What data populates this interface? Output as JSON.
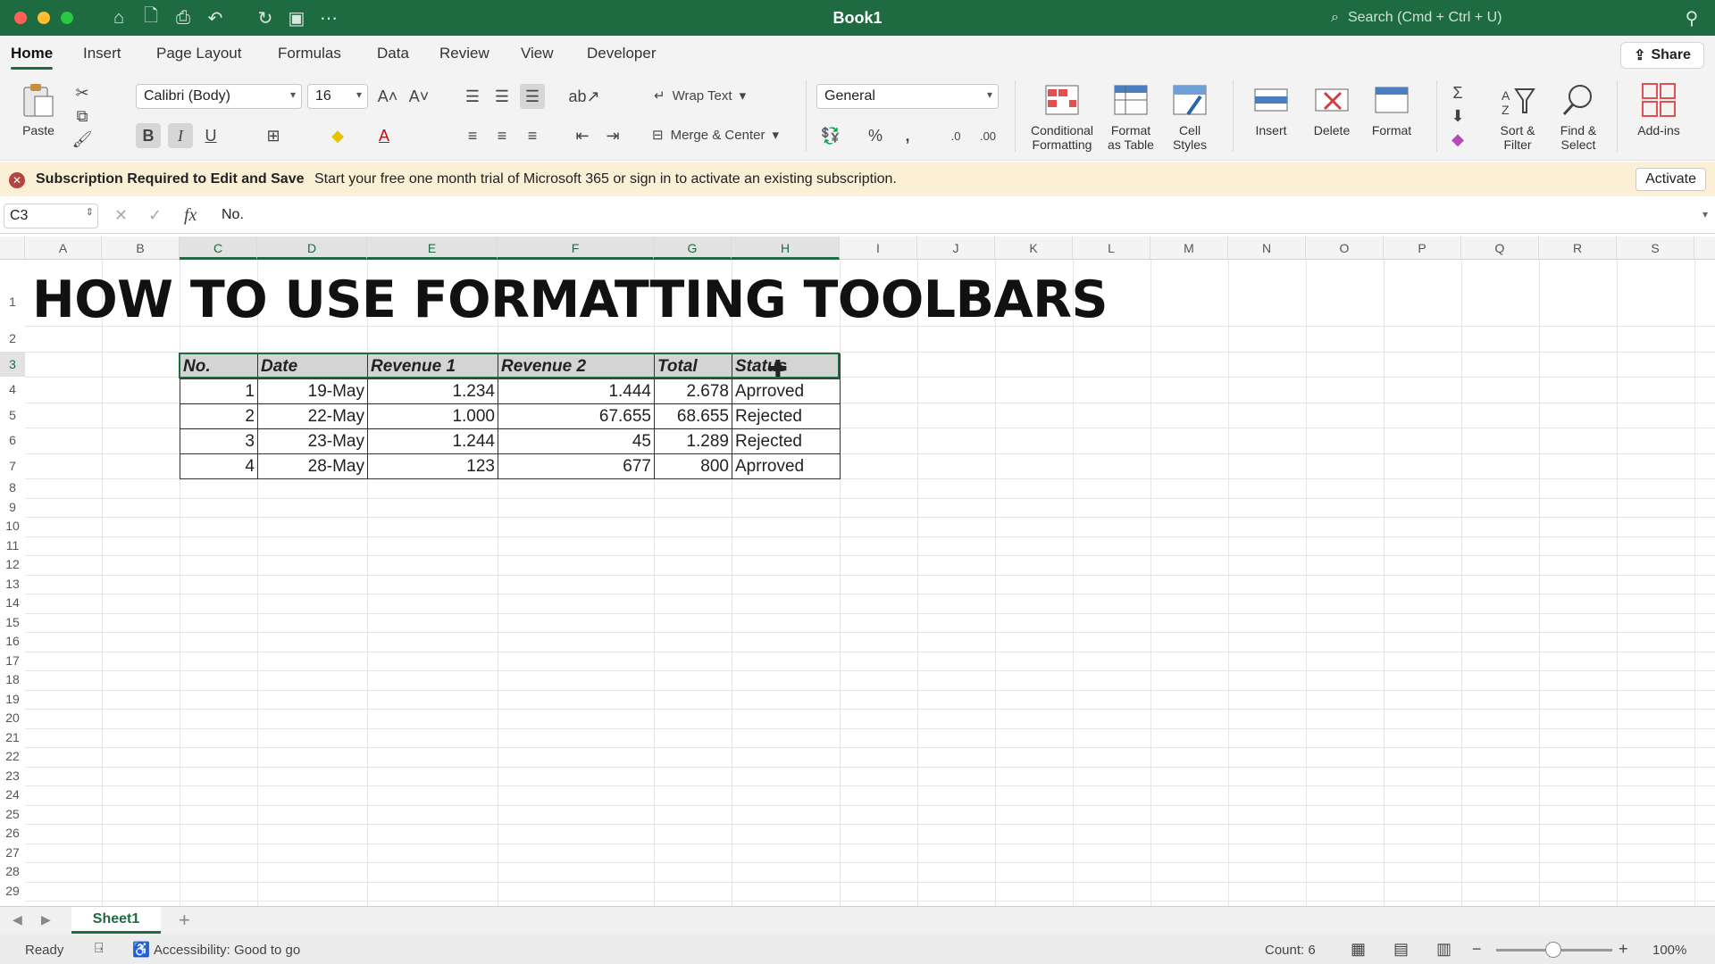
{
  "app": {
    "title": "Book1",
    "search_placeholder": "Search (Cmd + Ctrl + U)"
  },
  "tabs": [
    "Home",
    "Insert",
    "Page Layout",
    "Formulas",
    "Data",
    "Review",
    "View",
    "Developer"
  ],
  "share_label": "Share",
  "ribbon": {
    "paste": "Paste",
    "font_name": "Calibri (Body)",
    "font_size": "16",
    "wrap_text": "Wrap Text",
    "merge_center": "Merge & Center",
    "number_format": "General",
    "conditional_formatting": [
      "Conditional",
      "Formatting"
    ],
    "format_as_table": [
      "Format",
      "as Table"
    ],
    "cell_styles": [
      "Cell",
      "Styles"
    ],
    "insert": "Insert",
    "delete": "Delete",
    "format": "Format",
    "sort_filter": [
      "Sort &",
      "Filter"
    ],
    "find_select": [
      "Find &",
      "Select"
    ],
    "add_ins": "Add-ins",
    "bold": "B",
    "italic": "I",
    "underline": "U"
  },
  "message": {
    "title": "Subscription Required to Edit and Save",
    "text": "Start your free one month trial of Microsoft 365 or sign in to activate an existing subscription.",
    "button": "Activate"
  },
  "formula_bar": {
    "cell_ref": "C3",
    "formula": "No."
  },
  "columns": [
    "A",
    "B",
    "C",
    "D",
    "E",
    "F",
    "G",
    "H",
    "I",
    "J",
    "K",
    "L",
    "M",
    "N",
    "O",
    "P",
    "Q",
    "R",
    "S"
  ],
  "rows": [
    "1",
    "2",
    "3",
    "4",
    "5",
    "6",
    "7",
    "8",
    "9",
    "10",
    "11",
    "12",
    "13",
    "14",
    "15",
    "16",
    "17",
    "18",
    "19",
    "20",
    "21",
    "22",
    "23",
    "24",
    "25",
    "26",
    "27",
    "28",
    "29"
  ],
  "sheet": {
    "title": "HOW TO USE FORMATTING TOOLBARS",
    "table_headers": [
      "No.",
      "Date",
      "Revenue 1",
      "Revenue 2",
      "Total",
      "Status"
    ],
    "table_rows": [
      [
        "1",
        "19-May",
        "1.234",
        "1.444",
        "2.678",
        "Aprroved"
      ],
      [
        "2",
        "22-May",
        "1.000",
        "67.655",
        "68.655",
        "Rejected"
      ],
      [
        "3",
        "23-May",
        "1.244",
        "45",
        "1.289",
        "Rejected"
      ],
      [
        "4",
        "28-May",
        "123",
        "677",
        "800",
        "Aprroved"
      ]
    ]
  },
  "sheet_tabs": [
    "Sheet1"
  ],
  "status": {
    "ready": "Ready",
    "accessibility": "Accessibility: Good to go",
    "count": "Count: 6",
    "zoom": "100%"
  },
  "colors": {
    "accent": "#1e6b41",
    "header_fill": "#d4d4d4",
    "message_bg": "#fbf0d5"
  }
}
